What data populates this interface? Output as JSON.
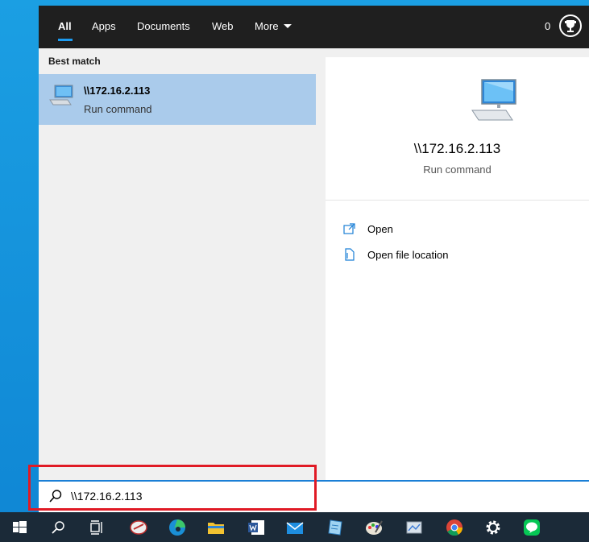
{
  "tabs": [
    {
      "label": "All",
      "active": true
    },
    {
      "label": "Apps"
    },
    {
      "label": "Documents"
    },
    {
      "label": "Web"
    },
    {
      "label": "More"
    }
  ],
  "header": {
    "points": "0"
  },
  "left": {
    "section_title": "Best match",
    "result": {
      "title": "\\\\172.16.2.113",
      "subtitle": "Run command"
    }
  },
  "detail": {
    "title": "\\\\172.16.2.113",
    "subtitle": "Run command",
    "actions": [
      {
        "label": "Open",
        "icon": "open-icon"
      },
      {
        "label": "Open file location",
        "icon": "file-location-icon"
      }
    ]
  },
  "search": {
    "value": "\\\\172.16.2.113"
  },
  "taskbar": {
    "items": [
      "start-icon",
      "search-icon",
      "task-view-icon",
      "app-icon",
      "edge-icon",
      "file-explorer-icon",
      "word-icon",
      "mail-icon",
      "notepad-icon",
      "paint-icon",
      "screenshot-app-icon",
      "chrome-icon",
      "settings-icon",
      "line-icon"
    ]
  },
  "colors": {
    "accent": "#1a7fd6",
    "selection": "#aacbeb",
    "highlight": "#e01a25"
  }
}
